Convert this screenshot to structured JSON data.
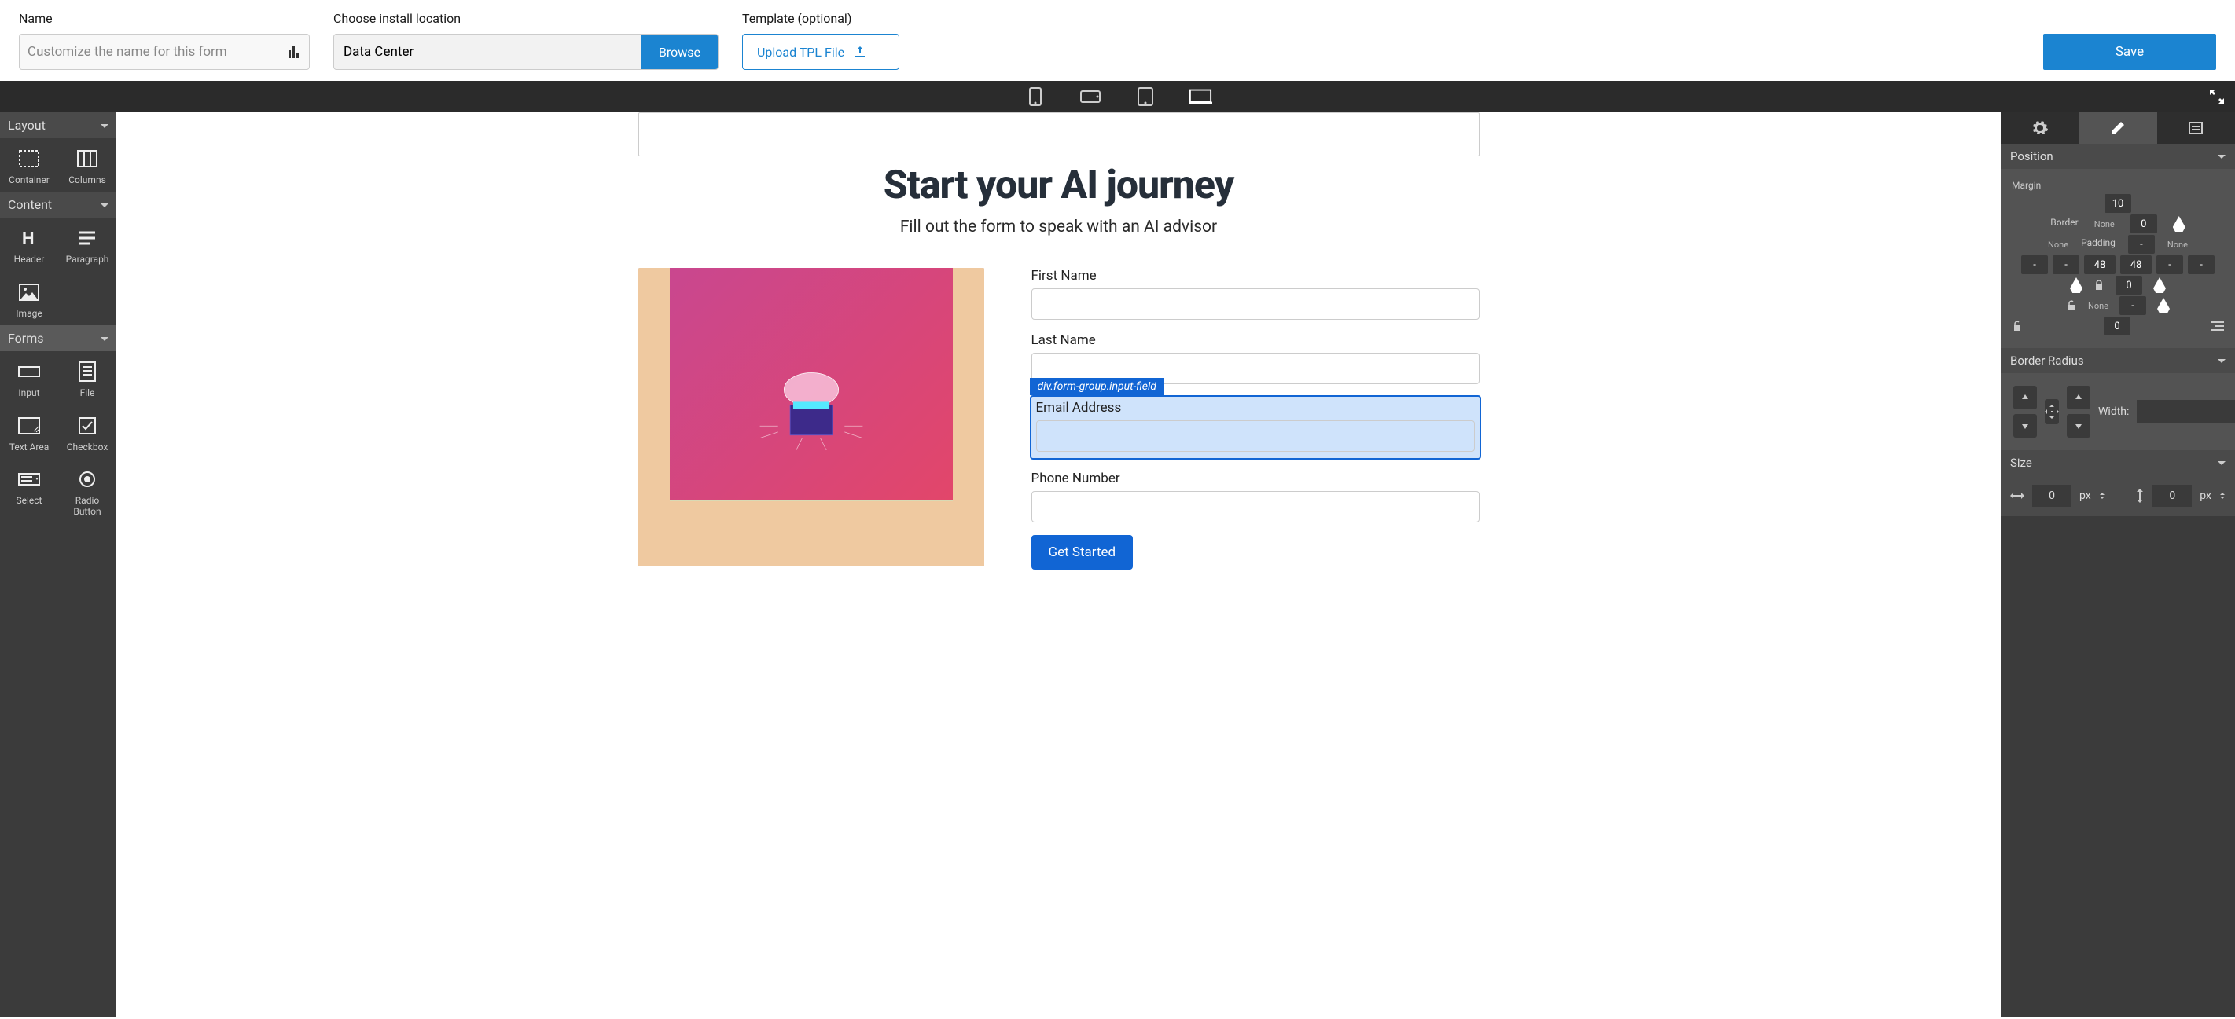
{
  "topbar": {
    "name_label": "Name",
    "name_placeholder": "Customize the name for this form",
    "install_label": "Choose install location",
    "install_value": "Data Center",
    "browse": "Browse",
    "template_label": "Template (optional)",
    "upload_tpl": "Upload TPL File",
    "save": "Save"
  },
  "left": {
    "section_layout": "Layout",
    "section_content": "Content",
    "section_forms": "Forms",
    "tools": {
      "container": "Container",
      "columns": "Columns",
      "header": "Header",
      "paragraph": "Paragraph",
      "image": "Image",
      "input": "Input",
      "file": "File",
      "textarea": "Text Area",
      "checkbox": "Checkbox",
      "select": "Select",
      "radio": "Radio Button"
    }
  },
  "canvas": {
    "title": "Start your AI journey",
    "subtitle": "Fill out the form to speak with an AI advisor",
    "first_name": "First Name",
    "last_name": "Last Name",
    "email": "Email Address",
    "phone": "Phone Number",
    "selected_tag": "div.form-group.input-field",
    "submit": "Get Started"
  },
  "right": {
    "position": "Position",
    "margin": "Margin",
    "border": "Border",
    "padding": "Padding",
    "none": "None",
    "vals": {
      "margin_top": "10",
      "border_top": "0",
      "padding_top": "-",
      "margin_left": "-",
      "border_left": "-",
      "padding_left": "48",
      "padding_right": "48",
      "border_right": "-",
      "margin_right": "-",
      "inner": "0",
      "padding_bottom": "-",
      "border_bottom": "0"
    },
    "border_radius": "Border Radius",
    "width": "Width:",
    "width_unit": "px",
    "size": "Size",
    "size_w": "0",
    "size_w_unit": "px",
    "size_h": "0",
    "size_h_unit": "px"
  }
}
